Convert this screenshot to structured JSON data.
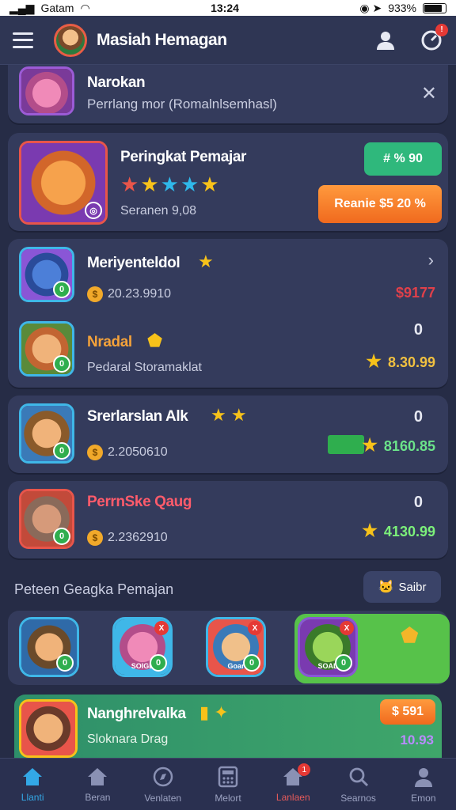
{
  "status_bar": {
    "carrier": "Gatam",
    "time": "13:24",
    "battery": "933%"
  },
  "header": {
    "title": "Masiah Hemagan",
    "notif_count": "!"
  },
  "notice": {
    "title": "Narokan",
    "subtitle": "Perrlang mor (Romalnlsemhasl)"
  },
  "featured": {
    "title": "Peringkat Pemajar",
    "subtitle": "Seranen 9,08",
    "button_green": "# % 90",
    "button_orange": "Reanie $5 20 %"
  },
  "leaders": [
    {
      "name": "Meriyenteldol",
      "sub": "20.23.9910",
      "value": "$9177",
      "value_color": "#e0404a"
    },
    {
      "name": "Nradal",
      "sub": "Pedaral Storamaklat",
      "zero": "0",
      "value": "8.30.99",
      "value_color": "#f0c040"
    },
    {
      "name": "Srerlarslan Alk",
      "sub": "2.2050610",
      "zero": "0",
      "value": "8160.85",
      "value_color": "#6be38a"
    },
    {
      "name": "PerrnSke Qaug",
      "sub": "2.2362910",
      "zero": "0",
      "value": "4130.99",
      "value_color": "#7cf07a"
    }
  ],
  "section": {
    "title": "Peteen Geagka Pemajan",
    "sort_label": "Saibr"
  },
  "row_avatars": [
    {
      "tag": ""
    },
    {
      "tag": "SOIGE"
    },
    {
      "tag": "Goar"
    },
    {
      "tag": "SOAL"
    }
  ],
  "promo": {
    "title": "Nanghrelvalka",
    "subtitle": "Sloknara Drag",
    "button": "$ 591",
    "value": "10.93"
  },
  "tabs": [
    {
      "label": "Llanti",
      "icon": "home-icon"
    },
    {
      "label": "Beran",
      "icon": "house-icon"
    },
    {
      "label": "Venlaten",
      "icon": "compass-icon"
    },
    {
      "label": "Melort",
      "icon": "calculator-icon"
    },
    {
      "label": "Lanlaen",
      "icon": "house-badge-icon"
    },
    {
      "label": "Searnos",
      "icon": "search-icon"
    },
    {
      "label": "Emon",
      "icon": "profile-icon"
    }
  ],
  "colors": {
    "accent": "#33a8e6",
    "green": "#2fb87c",
    "orange": "#f06a1e",
    "bg": "#262c46"
  }
}
